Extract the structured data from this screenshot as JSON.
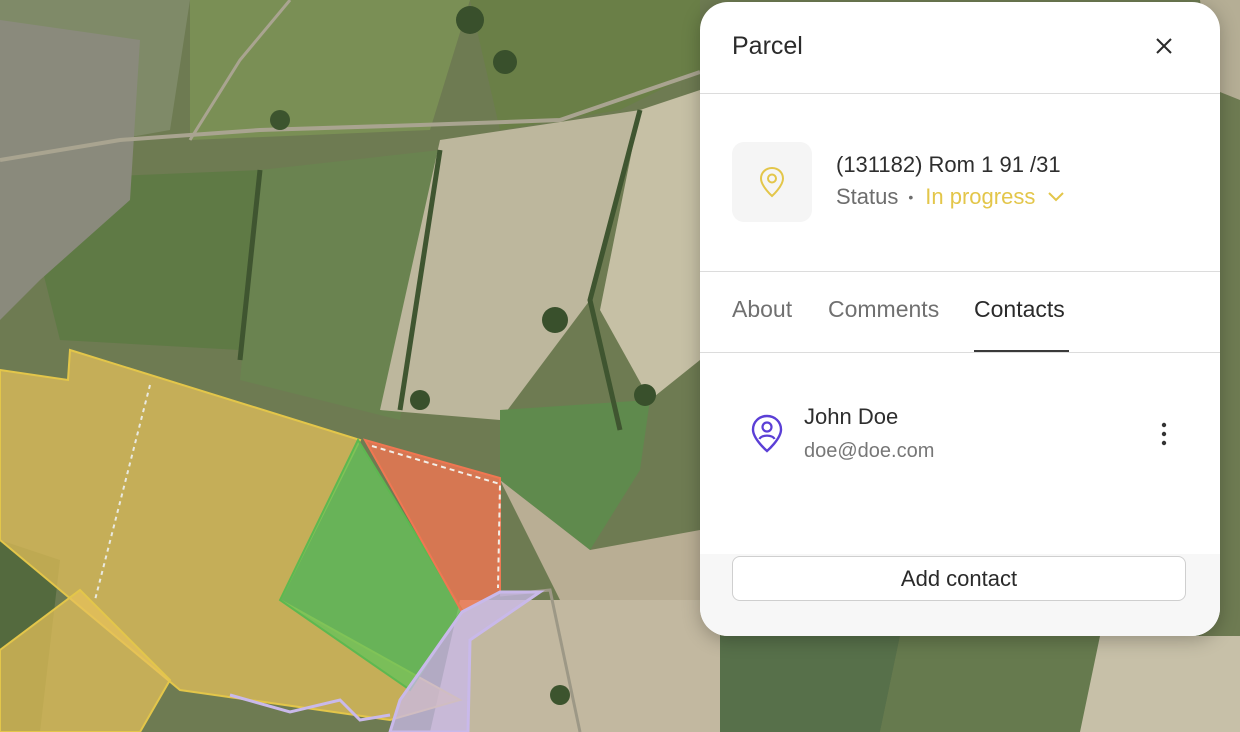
{
  "panel": {
    "title": "Parcel",
    "parcel_name": "(131182) Rom 1 91 /31",
    "status_label": "Status",
    "status_separator": "•",
    "status_value": "In progress",
    "tabs": [
      "About",
      "Comments",
      "Contacts"
    ],
    "active_tab": "Contacts",
    "contacts": [
      {
        "name": "John Doe",
        "email": "doe@doe.com"
      }
    ],
    "add_contact_label": "Add contact"
  },
  "colors": {
    "status_in_progress": "#e3c64a",
    "contact_icon": "#5b3fd6",
    "parcel_yellow": "#e8c25a",
    "parcel_green": "#66c25a",
    "parcel_red": "#f07752",
    "parcel_lavender": "#c9b9ea"
  },
  "icons": {
    "close": "close-icon",
    "location": "location-pin-icon",
    "chevron": "chevron-down-icon",
    "contact": "contact-pin-icon",
    "more": "more-vertical-icon"
  }
}
